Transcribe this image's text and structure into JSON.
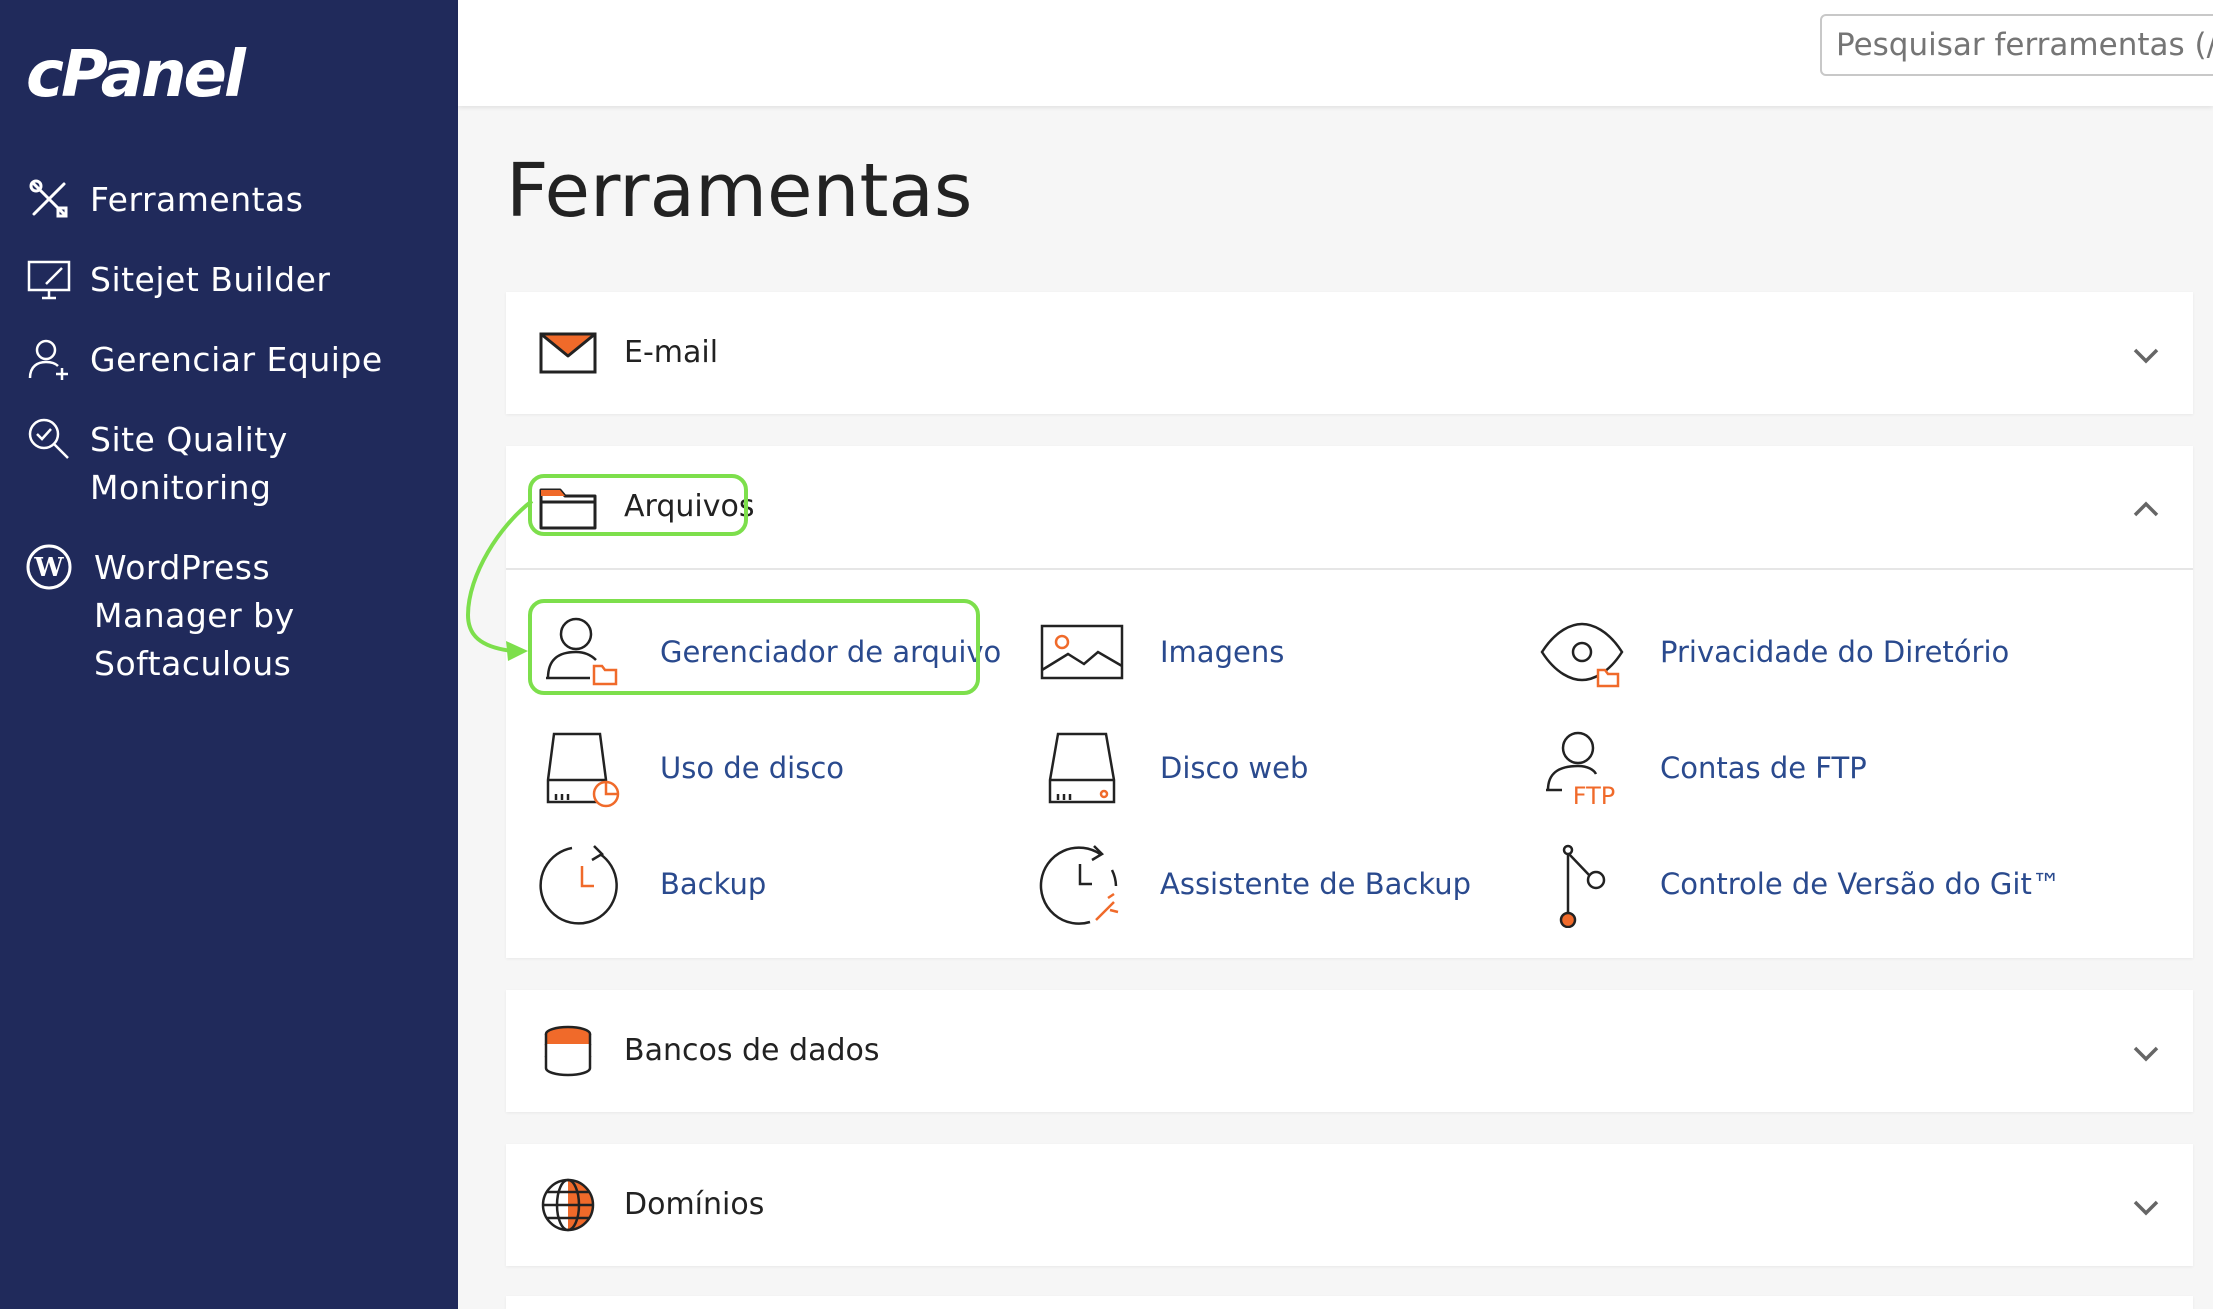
{
  "sidebar": {
    "logo": "cPanel",
    "items": [
      {
        "label": "Ferramentas",
        "icon": "tools-icon"
      },
      {
        "label": "Sitejet Builder",
        "icon": "monitor-builder-icon"
      },
      {
        "label": "Gerenciar Equipe",
        "icon": "team-user-icon"
      },
      {
        "label": "Site Quality Monitoring",
        "icon": "magnifier-check-icon"
      },
      {
        "label": "WordPress Manager by Softaculous",
        "icon": "wordpress-icon"
      }
    ]
  },
  "topbar": {
    "search_placeholder": "Pesquisar ferramentas (/)"
  },
  "page": {
    "title": "Ferramentas"
  },
  "sections": {
    "email": {
      "title": "E-mail",
      "state": "collapsed"
    },
    "arquivos": {
      "title": "Arquivos",
      "state": "expanded",
      "tools": [
        {
          "label": "Gerenciador de arquivo",
          "icon": "file-manager-icon"
        },
        {
          "label": "Imagens",
          "icon": "images-icon"
        },
        {
          "label": "Privacidade do Diretório",
          "icon": "directory-privacy-icon"
        },
        {
          "label": "Uso de disco",
          "icon": "disk-usage-icon"
        },
        {
          "label": "Disco web",
          "icon": "web-disk-icon"
        },
        {
          "label": "Contas de FTP",
          "icon": "ftp-accounts-icon"
        },
        {
          "label": "Backup",
          "icon": "backup-icon"
        },
        {
          "label": "Assistente de Backup",
          "icon": "backup-wizard-icon"
        },
        {
          "label": "Controle de Versão do Git™",
          "icon": "git-icon"
        }
      ]
    },
    "bancos": {
      "title": "Bancos de dados",
      "state": "collapsed"
    },
    "dominios": {
      "title": "Domínios",
      "state": "collapsed"
    }
  },
  "colors": {
    "sidebar_bg": "#202a5b",
    "accent_orange": "#f06a2a",
    "link_blue": "#2a4a8e",
    "highlight_green": "#7ddf4c"
  }
}
